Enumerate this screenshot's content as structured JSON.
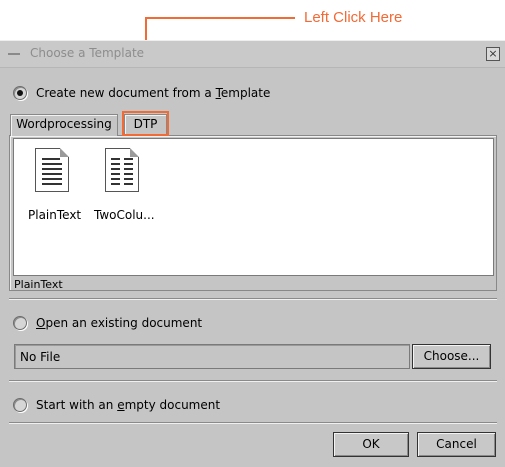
{
  "annotation": {
    "text": "Left Click Here"
  },
  "window": {
    "title": "Choose a Template",
    "close_symbol": "×"
  },
  "template_option": {
    "label_before": "Create new document from a ",
    "label_underline": "T",
    "label_after": "emplate",
    "selected": true
  },
  "tabs": [
    {
      "label": "Wordprocessing"
    },
    {
      "label": "DTP"
    }
  ],
  "templates": [
    {
      "label": "PlainText"
    },
    {
      "label": "TwoColu..."
    }
  ],
  "status": {
    "text": "PlainText"
  },
  "open_option": {
    "label_underline": "O",
    "label_after": "pen an existing document"
  },
  "file_field": {
    "value": "No File"
  },
  "choose_button": {
    "label": "Choose..."
  },
  "empty_option": {
    "label_before": "Start with an ",
    "label_underline": "e",
    "label_after": "mpty document"
  },
  "ok_button": {
    "label": "OK"
  },
  "cancel_button": {
    "label": "Cancel"
  }
}
